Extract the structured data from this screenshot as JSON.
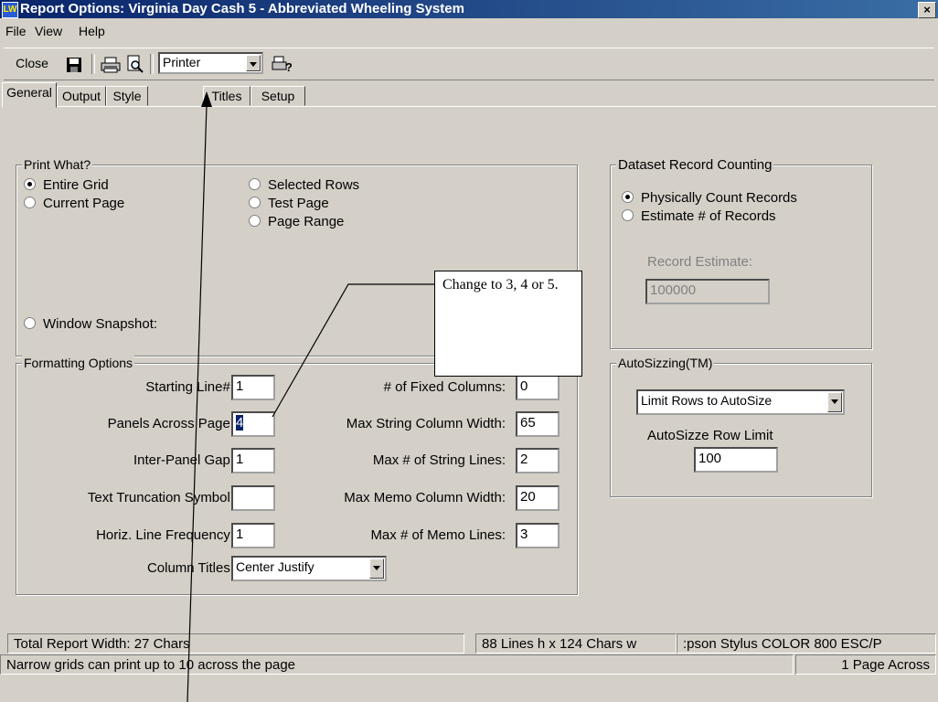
{
  "window": {
    "title": "Report Options: Virginia Day Cash 5 - Abbreviated Wheeling System",
    "app_icon": "LW",
    "close_glyph": "×"
  },
  "menu": {
    "items": [
      "File",
      "View",
      "Help"
    ]
  },
  "toolbar": {
    "close_label": "Close",
    "printer_value": "Printer"
  },
  "tabs": [
    "General",
    "Output",
    "Style",
    "Titles",
    "Setup"
  ],
  "print_what": {
    "title": "Print What?",
    "options": [
      "Entire Grid",
      "Current Page",
      "Selected Rows",
      "Test Page",
      "Page Range",
      "Window Snapshot:"
    ],
    "selected": "Entire Grid"
  },
  "dataset": {
    "title": "Dataset Record Counting",
    "options": [
      "Physically Count Records",
      "Estimate # of Records"
    ],
    "record_estimate_label": "Record Estimate:",
    "record_estimate_value": "100000"
  },
  "formatting": {
    "title": "Formatting Options",
    "starting_line_label": "Starting Line#:",
    "starting_line_value": "1",
    "panels_across_label": "Panels Across Page:",
    "panels_across_value": "4",
    "inter_panel_gap_label": "Inter-Panel Gap:",
    "inter_panel_gap_value": "1",
    "text_truncation_label": "Text Truncation Symbol:",
    "text_truncation_value": "",
    "horiz_line_freq_label": "Horiz. Line Frequency:",
    "horiz_line_freq_value": "1",
    "column_titles_label": "Column Titles:",
    "column_titles_value": "Center Justify",
    "fixed_columns_label": "# of Fixed Columns:",
    "fixed_columns_value": "0",
    "max_string_width_label": "Max String Column Width:",
    "max_string_width_value": "65",
    "max_string_lines_label": "Max # of String Lines:",
    "max_string_lines_value": "2",
    "max_memo_width_label": "Max Memo Column Width:",
    "max_memo_width_value": "20",
    "max_memo_lines_label": "Max # of Memo Lines:",
    "max_memo_lines_value": "3"
  },
  "autosizing": {
    "title": "AutoSizzing(TM)",
    "mode_value": "Limit Rows to AutoSize",
    "row_limit_label": "AutoSizze Row Limit",
    "row_limit_value": "100"
  },
  "status": {
    "total_width": "Total Report Width: 27 Chars",
    "lines_chars": "88 Lines h x 124 Chars w",
    "printer_name": ":pson Stylus COLOR 800 ESC/P",
    "hint": "Narrow grids can print up to 10 across the page",
    "pages_across": "1 Page Across"
  },
  "annotation": {
    "callout_text": "Change to 3, 4 or 5."
  }
}
